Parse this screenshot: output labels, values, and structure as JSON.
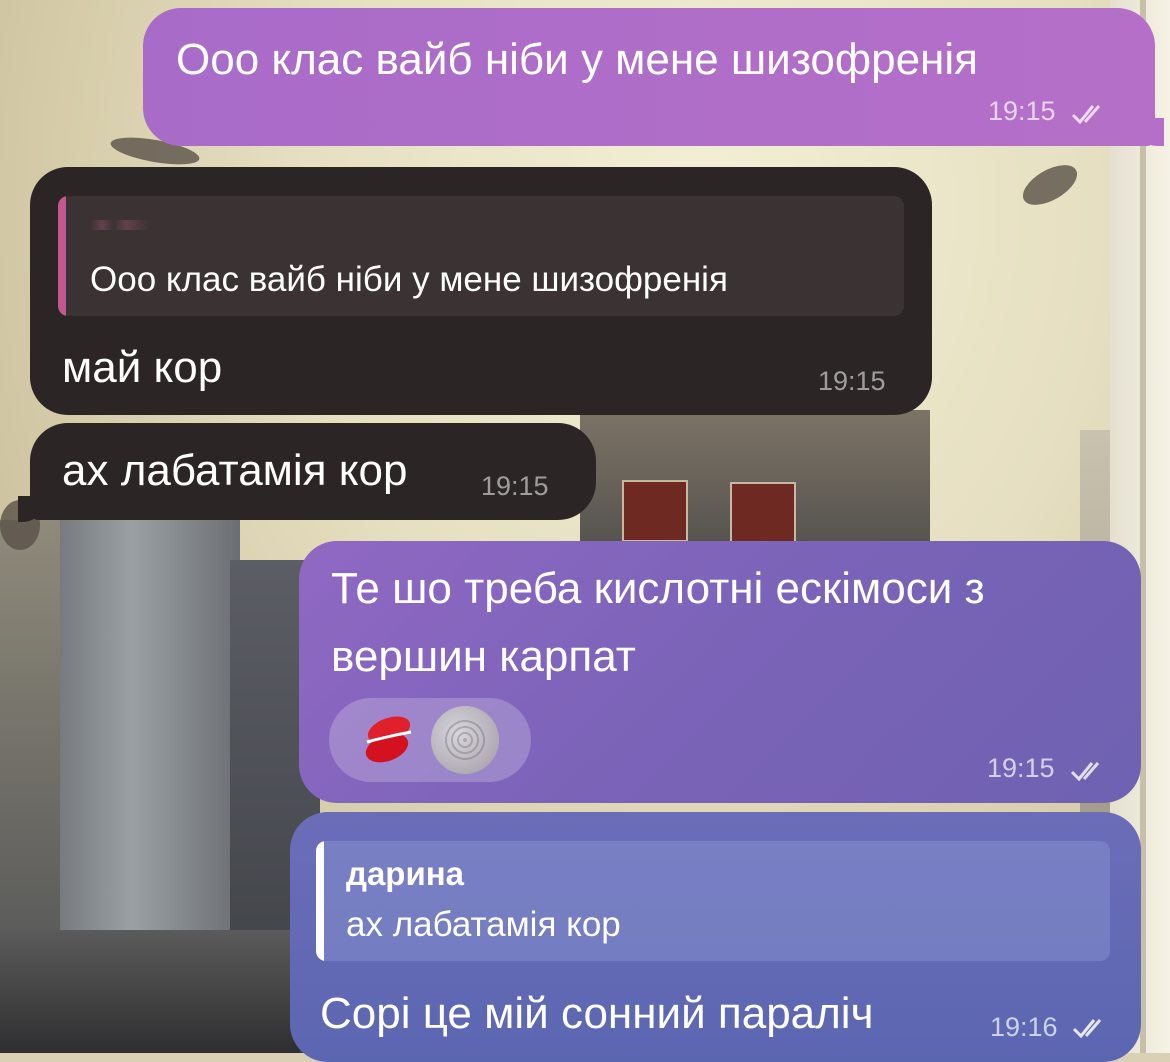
{
  "messages": [
    {
      "id": "m1",
      "direction": "outgoing",
      "text": "Ооо клас вайб ніби у мене шизофренія",
      "time": "19:15",
      "status": "read"
    },
    {
      "id": "m2",
      "direction": "incoming",
      "reply": {
        "text": "Ооо клас вайб ніби у мене шизофренія"
      },
      "text": "май кор",
      "time": "19:15"
    },
    {
      "id": "m3",
      "direction": "incoming",
      "text": "ах лабатамія кор",
      "time": "19:15"
    },
    {
      "id": "m4",
      "direction": "outgoing",
      "text_lines": [
        "Те шо треба кислотні ескімоси з",
        "вершин карпат"
      ],
      "reaction_icon": "kiss-mark-icon",
      "time": "19:15",
      "status": "read"
    },
    {
      "id": "m5",
      "direction": "outgoing",
      "reply": {
        "author": "дарина",
        "text": "ах лабатамія кор"
      },
      "text": "Сорі це мій сонний параліч",
      "time": "19:16",
      "status": "read"
    }
  ],
  "colors": {
    "outgoing_purple": "#b56fc9",
    "incoming_dark": "#2b2525",
    "outgoing_violet": "#7a63b8",
    "outgoing_blue": "#5b66b1",
    "reply_bar_pink": "#c2588f"
  }
}
